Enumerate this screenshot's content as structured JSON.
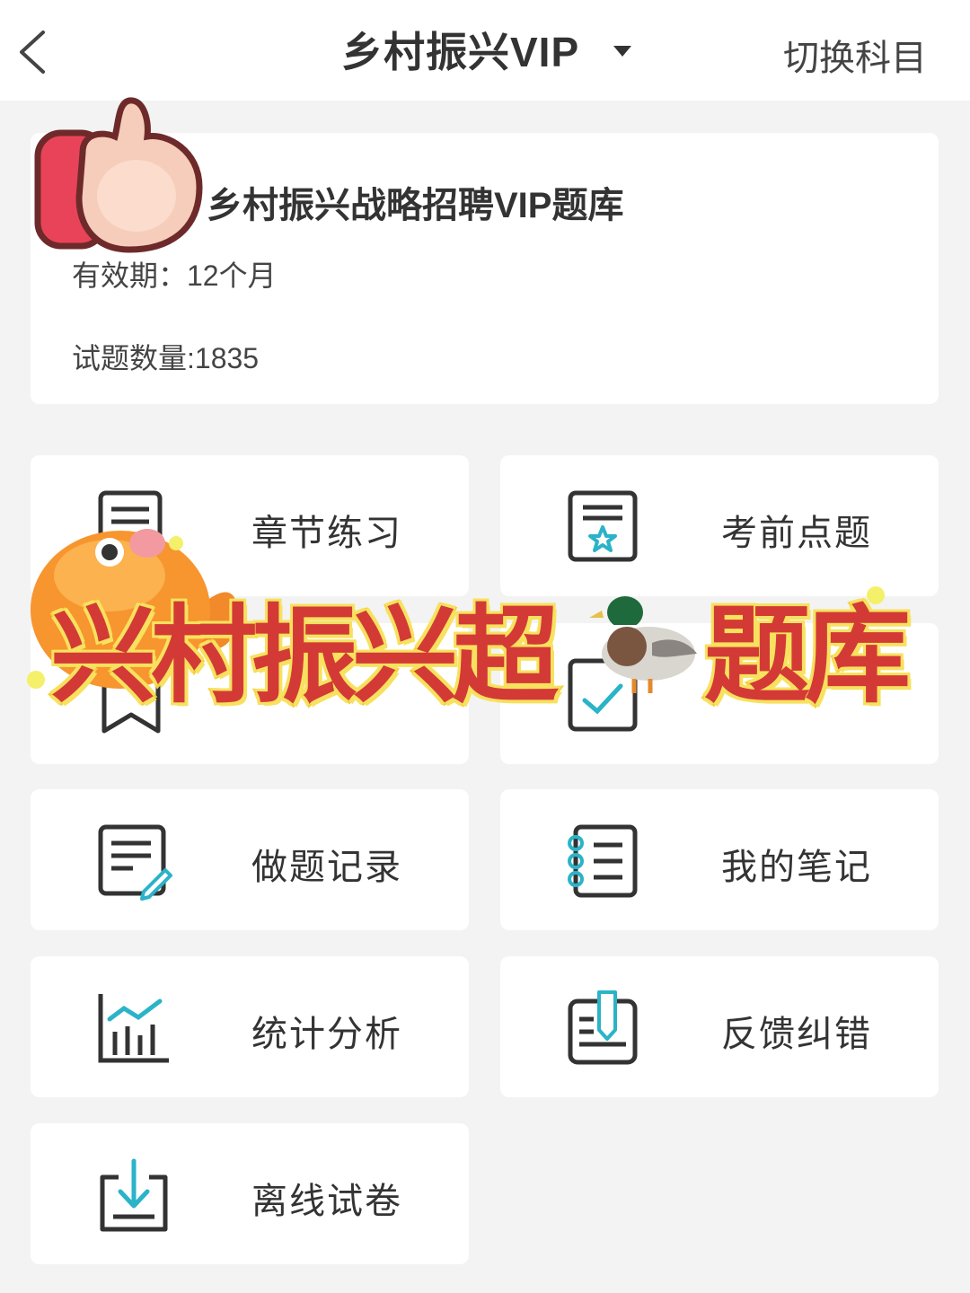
{
  "header": {
    "title": "乡村振兴VIP",
    "switch_label": "切换科目"
  },
  "info": {
    "title": "乡村振兴战略招聘VIP题库",
    "validity": "有效期：12个月",
    "count": "试题数量:1835"
  },
  "tiles": [
    {
      "label": "章节练习",
      "icon": "document-lines-icon"
    },
    {
      "label": "考前点题",
      "icon": "star-document-icon"
    },
    {
      "label": "",
      "icon": "bookmark-icon"
    },
    {
      "label": "",
      "icon": "check-document-icon"
    },
    {
      "label": "做题记录",
      "icon": "pencil-document-icon"
    },
    {
      "label": "我的笔记",
      "icon": "spiral-notebook-icon"
    },
    {
      "label": "统计分析",
      "icon": "bar-chart-icon"
    },
    {
      "label": "反馈纠错",
      "icon": "feedback-pen-icon"
    },
    {
      "label": "离线试卷",
      "icon": "download-icon"
    }
  ],
  "overlay": {
    "banner_left": "兴村振兴超",
    "banner_right": "题库"
  },
  "colors": {
    "accent": "#2bb3c8",
    "icon_dark": "#333333",
    "banner_red": "#d33a36",
    "banner_yellow": "#f4d13a"
  }
}
